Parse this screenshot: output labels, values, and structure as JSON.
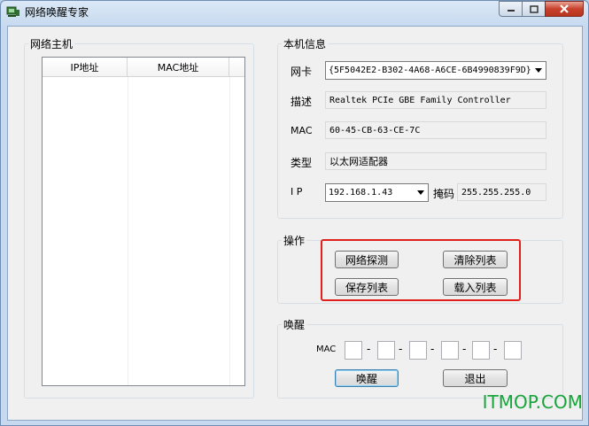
{
  "window": {
    "title": "网络唤醒专家"
  },
  "hosts": {
    "group_title": "网络主机",
    "columns": [
      "IP地址",
      "MAC地址"
    ]
  },
  "local_info": {
    "group_title": "本机信息",
    "nic_label": "网卡",
    "nic_value": "{5F5042E2-B302-4A68-A6CE-6B4990839F9D}",
    "desc_label": "描述",
    "desc_value": "Realtek PCIe GBE Family Controller",
    "mac_label": "MAC",
    "mac_value": "60-45-CB-63-CE-7C",
    "type_label": "类型",
    "type_value": "以太网适配器",
    "ip_label": "I P",
    "ip_value": "192.168.1.43",
    "mask_label": "掩码",
    "mask_value": "255.255.255.0"
  },
  "operations": {
    "group_title": "操作",
    "scan_label": "网络探测",
    "clear_label": "清除列表",
    "save_label": "保存列表",
    "load_label": "载入列表"
  },
  "wake": {
    "group_title": "唤醒",
    "mac_label": "MAC",
    "separator": "-",
    "wake_label": "唤醒",
    "exit_label": "退出"
  },
  "watermark": "ITMOP.COM"
}
